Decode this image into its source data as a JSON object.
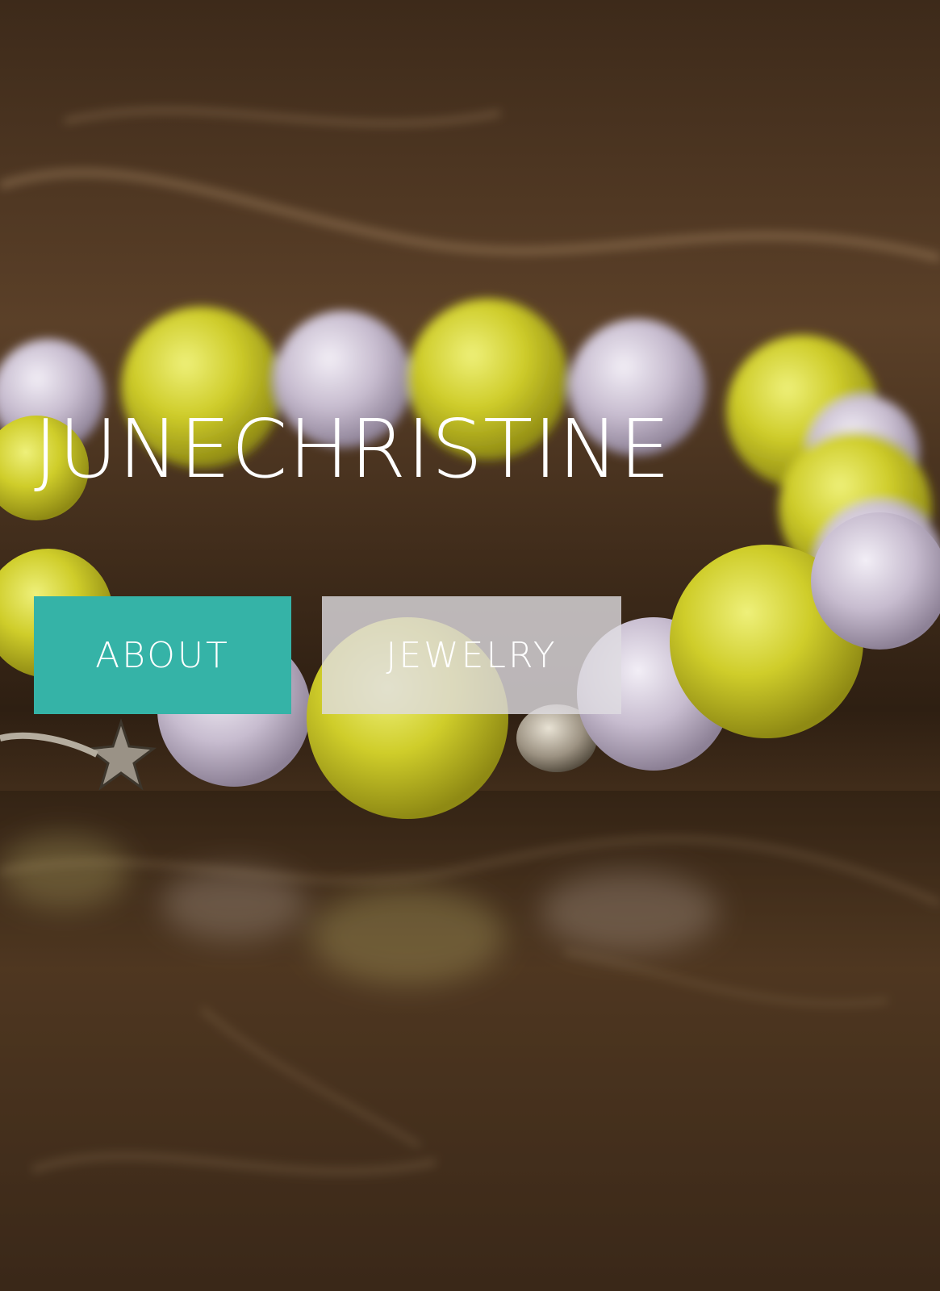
{
  "site": {
    "title": "JUNECHRISTINE"
  },
  "nav": {
    "buttons": [
      {
        "label": "ABOUT",
        "color": "#35b3a7"
      },
      {
        "label": "JEWELRY",
        "color": "#dedce1"
      }
    ]
  },
  "hero_image": {
    "subject": "bracelet-photo"
  }
}
